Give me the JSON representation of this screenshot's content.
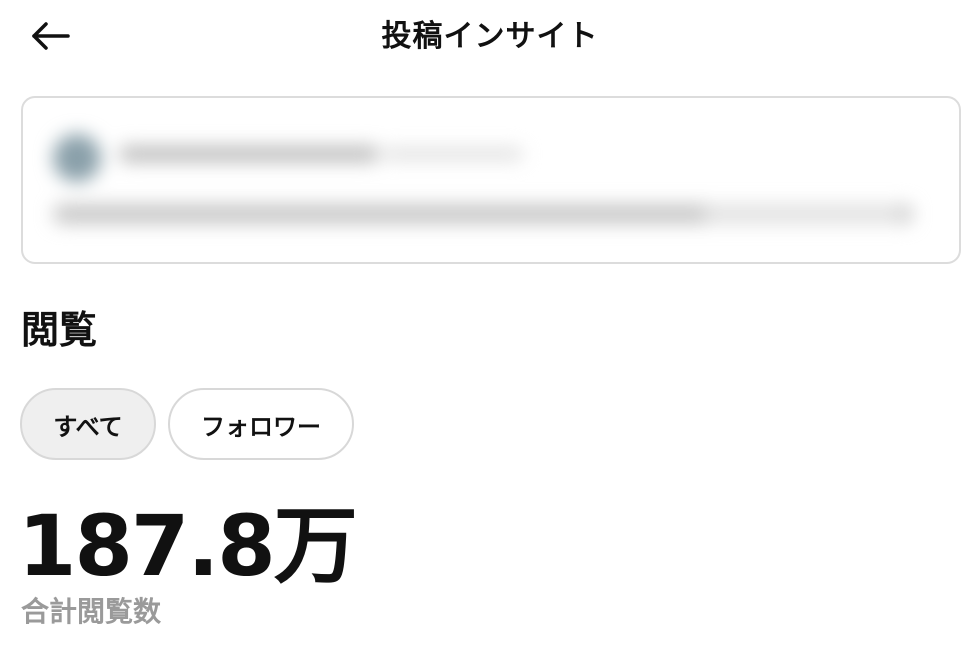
{
  "header": {
    "title": "投稿インサイト",
    "back_icon": "arrow-left-icon"
  },
  "post_preview": {
    "state": "blurred"
  },
  "views_section": {
    "heading": "閲覧",
    "filters": [
      {
        "label": "すべて",
        "selected": true
      },
      {
        "label": "フォロワー",
        "selected": false
      }
    ],
    "total_value": "187.8万",
    "total_label": "合計閲覧数"
  }
}
